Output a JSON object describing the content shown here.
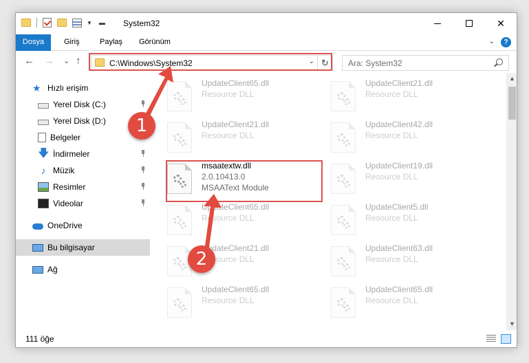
{
  "window": {
    "title": "System32",
    "close_glyph": "✕"
  },
  "ribbon": {
    "tabs": [
      "Dosya",
      "Giriş",
      "Paylaş",
      "Görünüm"
    ],
    "help": "?"
  },
  "navigation": {
    "back": "←",
    "forward": "→",
    "recent": "⌄",
    "up": "↑",
    "address": "C:\\Windows\\System32",
    "refresh": "↻",
    "search_placeholder": "Ara: System32"
  },
  "sidebar": {
    "items": [
      {
        "label": "Hızlı erişim",
        "icon": "quick-access-icon"
      },
      {
        "label": "Yerel Disk (C:)",
        "icon": "disk-icon",
        "pinned": true
      },
      {
        "label": "Yerel Disk (D:)",
        "icon": "disk-icon"
      },
      {
        "label": "Belgeler",
        "icon": "documents-icon"
      },
      {
        "label": "İndirmeler",
        "icon": "downloads-icon",
        "pinned": true
      },
      {
        "label": "Müzik",
        "icon": "music-icon",
        "pinned": true
      },
      {
        "label": "Resimler",
        "icon": "pictures-icon",
        "pinned": true
      },
      {
        "label": "Videolar",
        "icon": "videos-icon",
        "pinned": true
      },
      {
        "label": "OneDrive",
        "icon": "onedrive-icon"
      },
      {
        "label": "Bu bilgisayar",
        "icon": "this-pc-icon",
        "selected": true
      },
      {
        "label": "Ağ",
        "icon": "network-icon"
      }
    ]
  },
  "files": {
    "left_column": [
      {
        "name": "UpdateClient65.dll",
        "desc": "Resource DLL"
      },
      {
        "name": "UpdateClient21.dll",
        "desc": "Resource DLL"
      },
      {
        "name": "msaatextw.dll",
        "version": "2.0.10413.0",
        "desc": "MSAAText Module",
        "highlighted": true
      },
      {
        "name": "UpdateClient65.dll",
        "desc": "Resource DLL"
      },
      {
        "name": "UpdateClient21.dll",
        "desc": "Resource DLL"
      },
      {
        "name": "UpdateClient65.dll",
        "desc": "Resource DLL"
      }
    ],
    "right_column": [
      {
        "name": "UpdateClient21.dll",
        "desc": "Resource DLL"
      },
      {
        "name": "UpdateClient42.dll",
        "desc": "Resource DLL"
      },
      {
        "name": "UpdateClient19.dll",
        "desc": "Resource DLL"
      },
      {
        "name": "UpdateClient5.dll",
        "desc": "Resource DLL"
      },
      {
        "name": "UpdateClient63.dll",
        "desc": "Resource DLL"
      },
      {
        "name": "UpdateClient65.dll",
        "desc": "Resource DLL"
      }
    ]
  },
  "status": {
    "count": "111 öğe"
  },
  "annotations": {
    "callout_1": "1",
    "callout_2": "2",
    "color": "#e24b3f"
  }
}
